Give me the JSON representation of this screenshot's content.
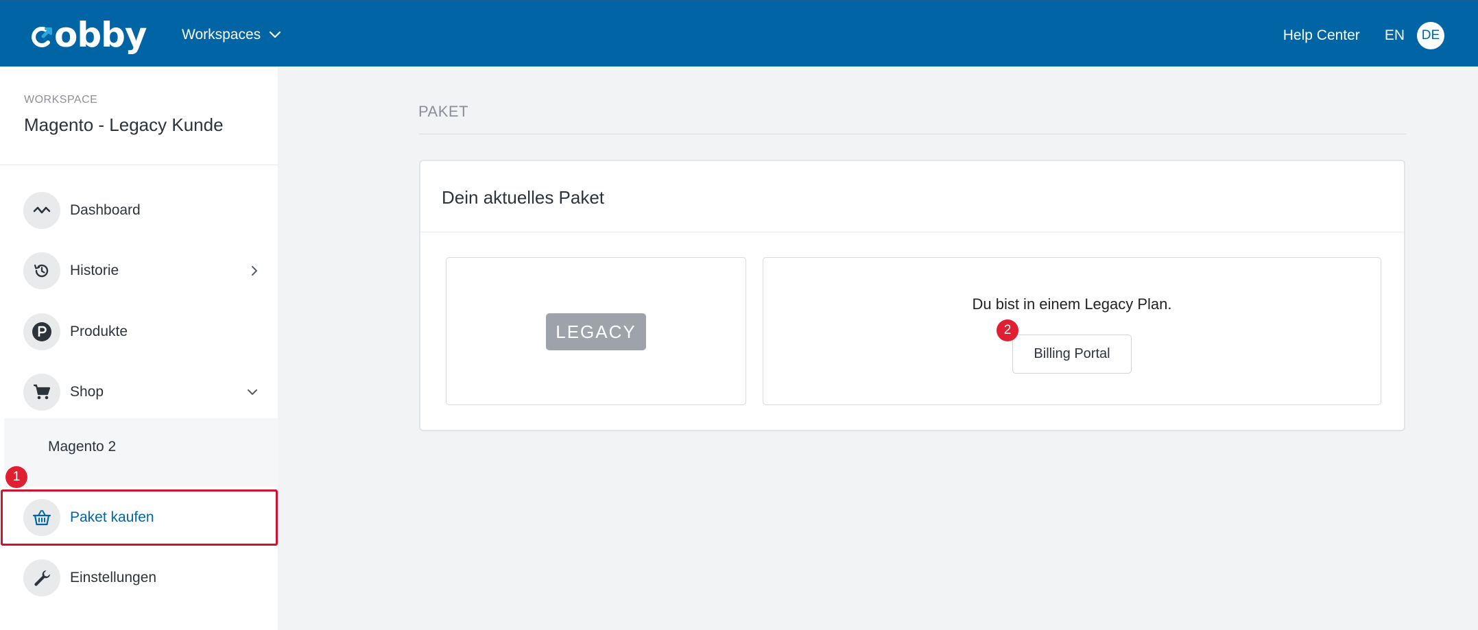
{
  "topbar": {
    "logo_text": "obby",
    "workspaces_label": "Workspaces",
    "help_center": "Help Center",
    "language": "EN",
    "avatar_initials": "DE"
  },
  "sidebar": {
    "workspace_caption": "WORKSPACE",
    "workspace_name": "Magento - Legacy Kunde",
    "items": [
      {
        "label": "Dashboard",
        "icon": "activity-icon"
      },
      {
        "label": "Historie",
        "icon": "history-icon"
      },
      {
        "label": "Produkte",
        "icon": "p-circle-icon"
      },
      {
        "label": "Shop",
        "icon": "cart-icon"
      },
      {
        "label": "Magento 2"
      },
      {
        "label": "Paket kaufen",
        "icon": "basket-icon"
      },
      {
        "label": "Einstellungen",
        "icon": "wrench-icon"
      }
    ]
  },
  "annotations": {
    "badge_1": "1",
    "badge_2": "2"
  },
  "main": {
    "section_title": "PAKET",
    "card_title": "Dein aktuelles Paket",
    "plan_tag": "LEGACY",
    "plan_message": "Du bist in einem Legacy Plan.",
    "billing_button": "Billing Portal"
  },
  "colors": {
    "brand": "#0064a5",
    "highlight": "#d0122e",
    "badge": "#e02032",
    "legacy_tag": "#9ea3ab"
  }
}
